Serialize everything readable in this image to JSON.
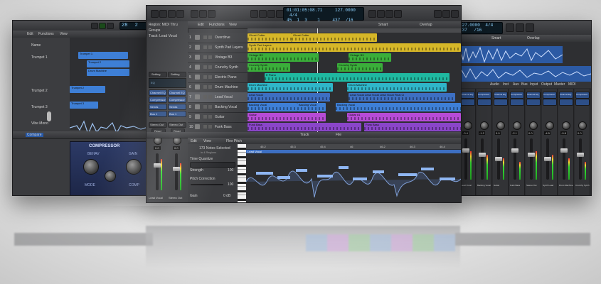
{
  "left_window": {
    "toolbar": {
      "edit": "Edit",
      "functions": "Functions",
      "view": "View",
      "lcd_bar": "28",
      "lcd_beat": "2"
    },
    "tracks": [
      {
        "name": "Name",
        "sub": ""
      },
      {
        "name": "Trumpet 1",
        "sub": ""
      },
      {
        "name": "Trumpet 2",
        "sub": ""
      },
      {
        "name": "Trumpet 3",
        "sub": ""
      },
      {
        "name": "Vibe Mono",
        "sub": ""
      }
    ],
    "regions": [
      "Trumpet 1",
      "Trumpet 2",
      "Drum Machine",
      "Trumpet 2",
      "Trumpet 3"
    ],
    "bottom_tab": "Compare",
    "plugin_title": "COMPRESSOR",
    "plugin_labels": [
      "BEHAV",
      "GAIN",
      "MODE",
      "COMP"
    ]
  },
  "center_window": {
    "toolbar": {
      "lcd_time": "01:01:05:08.71",
      "lcd_bars": "45  1  3    1",
      "lcd_tempo": "127.0000",
      "lcd_sig": "4/4",
      "lcd_key": "437",
      "lcd_division": "/16",
      "mode": "Smart",
      "overlap": "Overlap"
    },
    "inspector": {
      "region": "Region: MIDI Thru",
      "groups": "Groups",
      "track": "Track: Lead Vocal",
      "setting_a": "Setting",
      "setting_b": "Setting",
      "eq": "EQ",
      "slot_labels": [
        "Channel EQ",
        "Compressor",
        "Sends",
        "Bus 1"
      ],
      "stereo_out_a": "Stereo Out",
      "stereo_out_b": "Stereo Out",
      "read_a": "Read",
      "read_b": "Read",
      "value_a": "0.0",
      "value_b": "0.0",
      "bottom_a": "Lead Vocal",
      "bottom_b": "Stereo Out"
    },
    "menu": {
      "edit": "Edit",
      "functions": "Functions",
      "view": "View"
    },
    "tracks": [
      {
        "num": "1",
        "name": "Overdrive"
      },
      {
        "num": "2",
        "name": "Synth Pad Layers"
      },
      {
        "num": "3",
        "name": "Vintage B3"
      },
      {
        "num": "4",
        "name": "Crunchy Synth"
      },
      {
        "num": "5",
        "name": "Electric Piano"
      },
      {
        "num": "6",
        "name": "Drum Machine"
      },
      {
        "num": "7",
        "name": "Lead Vocal"
      },
      {
        "num": "8",
        "name": "Backing Vocal"
      },
      {
        "num": "9",
        "name": "Guitar"
      },
      {
        "num": "10",
        "name": "Funk Bass"
      }
    ],
    "regions": [
      {
        "label": "Ghost Cutter",
        "track": 0
      },
      {
        "label": "Ghost Cutter",
        "track": 0
      },
      {
        "label": "Synth Pad Layers",
        "track": 1
      },
      {
        "label": "Vintage B3",
        "track": 2
      },
      {
        "label": "Vintage B3",
        "track": 2
      },
      {
        "label": "Crunchy Synth",
        "track": 3
      },
      {
        "label": "Crunchy Synth",
        "track": 3
      },
      {
        "label": "E Piano",
        "track": 4
      },
      {
        "label": "Drum Machine",
        "track": 5
      },
      {
        "label": "Drum Machine",
        "track": 5
      },
      {
        "label": "Lead Vocal",
        "track": 6
      },
      {
        "label": "Lead Vocal  Lead Vocal  Lead Vocal  Final Cl",
        "track": 6
      },
      {
        "label": "Backing Vocal",
        "track": 7
      },
      {
        "label": "Backing Vocal",
        "track": 7
      },
      {
        "label": "Backing Vocal",
        "track": 7
      },
      {
        "label": "Guitar",
        "track": 8
      },
      {
        "label": "Guitar #1",
        "track": 8
      },
      {
        "label": "Funk Bass",
        "track": 9
      },
      {
        "label": "Funk Bass",
        "track": 9
      }
    ],
    "editor_tabs": [
      "Track",
      "File"
    ],
    "editor_menu": {
      "edit": "Edit",
      "view": "View",
      "flex": "Flex Pitch"
    },
    "editor_panel": {
      "title": "Lead Vocal",
      "selection": "173 Notes Selected",
      "selection_sub": "in 4 Regions",
      "time_quantize": "Time Quantize",
      "strength": "Strength",
      "strength_val": "100",
      "pitch_correction": "Pitch Correction",
      "pitch_val": "100",
      "gain": "Gain",
      "gain_val": "0 dB"
    },
    "ruler": [
      "45.2",
      "45.3",
      "45.4",
      "46",
      "46.2",
      "46.3",
      "46.4"
    ],
    "editor_region": "Lead Vocal"
  },
  "right_window": {
    "toolbar": {
      "lcd_tempo": "127.0000",
      "lcd_sig": "4/4",
      "lcd_key": "437",
      "lcd_div": "/16",
      "mode": "Smart",
      "overlap": "Overlap"
    },
    "tabs": [
      "Audio",
      "Inst",
      "Aux",
      "Bus",
      "Input",
      "Output",
      "Master",
      "MIDI"
    ],
    "slots": [
      "Channel EQ",
      "Compressor",
      "Channel EQ",
      "Compressor",
      "Channel EQ",
      "Compressor",
      "Channel EQ",
      "Compressor"
    ],
    "strip_names": [
      "Lead Vocal",
      "Backing Vocal",
      "Guitar",
      "Funk Bass",
      "Stereo Out",
      "Synth Lead",
      "Drum Machine",
      "Crunchy Synth"
    ],
    "values": [
      "-3.4",
      "-1.2",
      "0.0",
      "-2.1",
      "0.0",
      "-4.5",
      "-0.8",
      "0.0"
    ]
  },
  "colors": {
    "yellow": "#d6b728",
    "green": "#3aae3a",
    "teal": "#1fb8a0",
    "cyan": "#2fb6c9",
    "blue": "#3e7fd6",
    "vocal_blue": "#3d6fc2",
    "purple": "#b64bd6",
    "violet": "#8a45c9",
    "lcd_text": "#8fd3ff"
  }
}
